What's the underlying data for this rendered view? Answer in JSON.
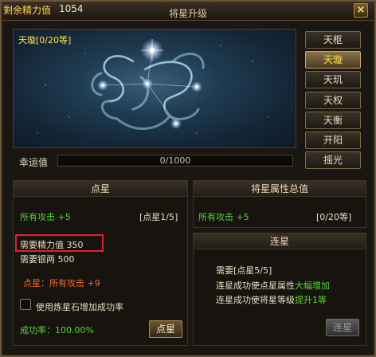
{
  "header": {
    "energy_label": "剩余精力值",
    "energy_value": "1054",
    "title": "将星升级",
    "close": "×"
  },
  "constellation": {
    "label": "天璇[0/20等]"
  },
  "stars": [
    {
      "label": "天枢",
      "active": false
    },
    {
      "label": "天璇",
      "active": true
    },
    {
      "label": "天玑",
      "active": false
    },
    {
      "label": "天权",
      "active": false
    },
    {
      "label": "天衡",
      "active": false
    },
    {
      "label": "开阳",
      "active": false
    },
    {
      "label": "摇光",
      "active": false
    }
  ],
  "luck": {
    "label": "幸运值",
    "value": "0/1000",
    "fraction": 0
  },
  "dianxing": {
    "title": "点星",
    "attr": "所有攻击 +5",
    "progress": "[点星1/5]",
    "need_energy": "需要精力值 350",
    "need_silver": "需要银两 500",
    "bonus": "点星：所有攻击 +9",
    "use_stone": "使用炼星石增加成功率",
    "success_rate": "成功率：100.00%",
    "button": "点星"
  },
  "total": {
    "title": "将星属性总值",
    "attr": "所有攻击 +5",
    "level": "[0/20等]"
  },
  "lianxing": {
    "title": "连星",
    "line1": "需要[点星5/5]",
    "line2_prefix": "连星成功使点星属性",
    "line2_highlight": "大幅增加",
    "line3_prefix": "连星成功使将星等级",
    "line3_highlight": "提升1等",
    "button": "连星"
  },
  "icons": {
    "close": "close-icon",
    "checkbox": "checkbox-icon"
  }
}
